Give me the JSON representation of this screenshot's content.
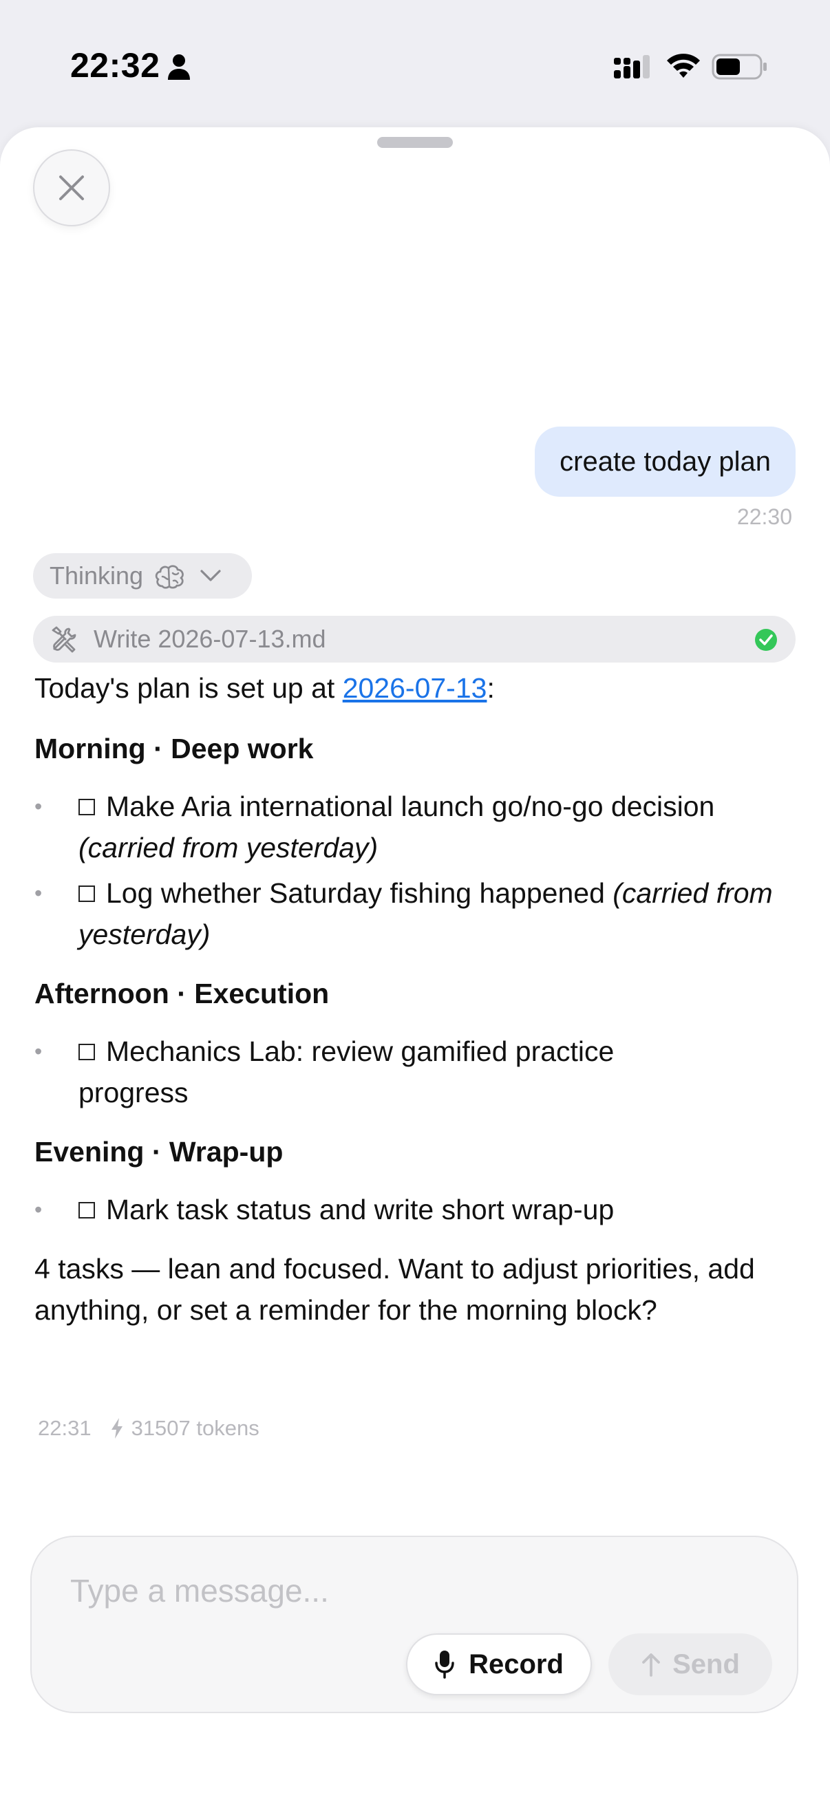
{
  "status_bar": {
    "time": "22:32"
  },
  "chat": {
    "user_message": {
      "text": "create today plan",
      "time": "22:30"
    },
    "thinking": {
      "label": "Thinking"
    },
    "tool_call": {
      "label": "Write 2026-07-13.md",
      "status": "success"
    },
    "assistant": {
      "intro_prefix": "Today's plan is set up at ",
      "intro_link": "2026-07-13",
      "intro_suffix": ":",
      "sections": [
        {
          "heading": "Morning · Deep work",
          "items": [
            {
              "text": "Make Aria international launch go/no-go decision",
              "note": "(carried from yesterday)"
            },
            {
              "text": "Log whether Saturday fishing happened",
              "note": "(carried from yesterday)"
            }
          ]
        },
        {
          "heading": "Afternoon · Execution",
          "items": [
            {
              "text": "Mechanics Lab: review gamified practice progress",
              "note": ""
            }
          ]
        },
        {
          "heading": "Evening · Wrap-up",
          "items": [
            {
              "text": "Mark task status and write short wrap-up",
              "note": ""
            }
          ]
        }
      ],
      "closing": "4 tasks — lean and focused. Want to adjust priorities, add anything, or set a reminder for the morning block?",
      "time": "22:31",
      "tokens": "31507 tokens"
    }
  },
  "composer": {
    "placeholder": "Type a message...",
    "value": "",
    "record_label": "Record",
    "send_label": "Send"
  },
  "colors": {
    "accent_link": "#1a73e8",
    "user_bubble": "#dfeafd",
    "success": "#34c759"
  }
}
